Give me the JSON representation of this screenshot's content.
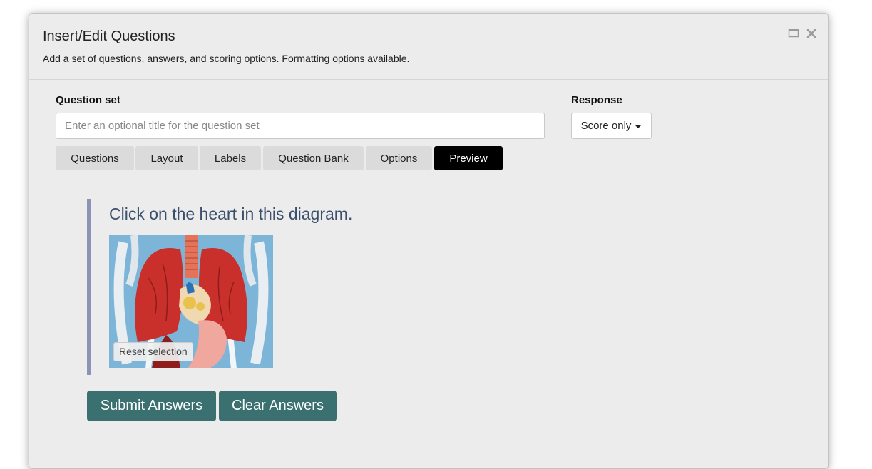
{
  "dialog": {
    "title": "Insert/Edit Questions",
    "subtitle": "Add a set of questions, answers, and scoring options. Formatting options available.",
    "controls": [
      "maximize-icon",
      "close-icon"
    ]
  },
  "question_set": {
    "label": "Question set",
    "placeholder": "Enter an optional title for the question set",
    "value": ""
  },
  "response": {
    "label": "Response",
    "selected": "Score only"
  },
  "tabs": [
    {
      "label": "Questions",
      "active": false
    },
    {
      "label": "Layout",
      "active": false
    },
    {
      "label": "Labels",
      "active": false
    },
    {
      "label": "Question Bank",
      "active": false
    },
    {
      "label": "Options",
      "active": false
    },
    {
      "label": "Preview",
      "active": true
    }
  ],
  "preview": {
    "question": "Click on the heart in this diagram.",
    "reset_label": "Reset selection",
    "submit_label": "Submit Answers",
    "clear_label": "Clear Answers"
  },
  "colors": {
    "accent_button": "#3a7070",
    "active_tab": "#000000",
    "question_text": "#3a4f6b",
    "question_border": "#8c94b4"
  }
}
